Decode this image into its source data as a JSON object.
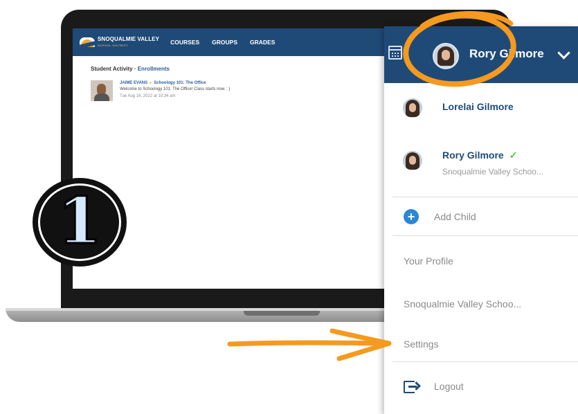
{
  "screen": {
    "brand_name": "SNOQUALMIE VALLEY",
    "brand_sub": "SCHOOL DISTRICT",
    "nav": [
      "COURSES",
      "GROUPS",
      "GRADES"
    ],
    "section_title_prefix": "Student Activity ·",
    "section_title_link": "Enrollments",
    "activity": {
      "who": "JAIME EVANS",
      "arrow": "▸",
      "course": "Schoology 101: The Office",
      "message": "Welcome to Schoology 101: The Office! Class starts now. : )",
      "date": "Tue Aug 16, 2022 at 10:34 am"
    }
  },
  "badge": {
    "number": "1"
  },
  "dropdown": {
    "header_name": "Rory Gilmore",
    "children": [
      {
        "name": "Lorelai Gilmore",
        "sub": ""
      },
      {
        "name": "Rory Gilmore",
        "sub": "Snoqualmie Valley Schoo...",
        "check": "✓"
      }
    ],
    "add_child": "Add Child",
    "add_icon": "+",
    "your_profile": "Your Profile",
    "district": "Snoqualmie Valley Schoo...",
    "settings": "Settings",
    "logout": "Logout"
  },
  "colors": {
    "navy": "#1f4a78",
    "annotation_orange": "#f59a1f",
    "check_green": "#5bbf4a"
  }
}
